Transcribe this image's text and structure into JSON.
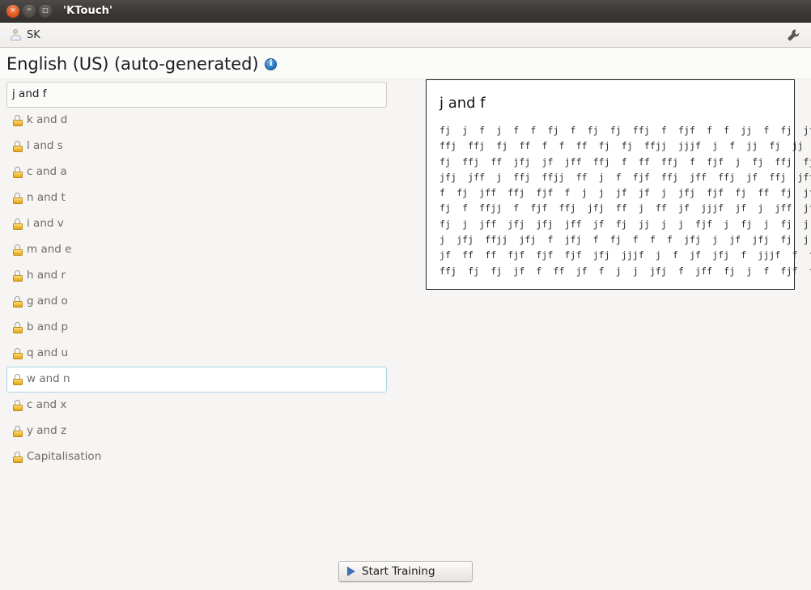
{
  "window": {
    "title": "'KTouch'",
    "controls": {
      "close": "×",
      "minimize": "–",
      "maximize": "□"
    }
  },
  "profile_bar": {
    "user": "SK",
    "avatar_icon": "user-avatar-icon",
    "configure_icon": "wrench-icon"
  },
  "header": {
    "title": "English (US) (auto-generated)",
    "info_icon": "info-icon",
    "info_glyph": "i"
  },
  "lessons": [
    {
      "label": "j and f",
      "locked": false,
      "state": "selected"
    },
    {
      "label": "k and d",
      "locked": true,
      "state": "normal"
    },
    {
      "label": "l and s",
      "locked": true,
      "state": "normal"
    },
    {
      "label": "c and a",
      "locked": true,
      "state": "normal"
    },
    {
      "label": "n and t",
      "locked": true,
      "state": "normal"
    },
    {
      "label": "i and v",
      "locked": true,
      "state": "normal"
    },
    {
      "label": "m and e",
      "locked": true,
      "state": "normal"
    },
    {
      "label": "h and r",
      "locked": true,
      "state": "normal"
    },
    {
      "label": "g and o",
      "locked": true,
      "state": "normal"
    },
    {
      "label": "b and p",
      "locked": true,
      "state": "normal"
    },
    {
      "label": "q and u",
      "locked": true,
      "state": "normal"
    },
    {
      "label": "w and n",
      "locked": true,
      "state": "hover"
    },
    {
      "label": "c and x",
      "locked": true,
      "state": "normal"
    },
    {
      "label": "y and z",
      "locked": true,
      "state": "normal"
    },
    {
      "label": "Capitalisation",
      "locked": true,
      "state": "normal"
    }
  ],
  "preview": {
    "title": "j and f",
    "lines": [
      "fj  j  f  j  f  f  fj  f  fj  fj  ffj  f  fjf  f  f  jj  f  fj  jf  jf  fj  jfj  fjf",
      "ffj  ffj  fj  ff  f  f  ff  fj  fj  ffjj  jjjf  j  f  jj  fj  jj  jfj  ff  f  ff  ff",
      "fj  ffj  ff  jfj  jf  jff  ffj  f  ff  ffj  f  fjf  j  fj  ffj  fj  jj  ffj  jj  f",
      "jfj  jff  j  ffj  ffjj  ff  j  f  fjf  ffj  jff  ffj  jf  ffj  jff  fj  fj  f  f  f",
      "f  fj  jff  ffj  fjf  f  j  j  jf  jf  j  jfj  fjf  fj  ff  fj  jfj  jfj  fj  jff",
      "fj  f  ffjj  f  fjf  ffj  jfj  ff  j  ff  jf  jjjf  jf  j  jff  jfj  j  f  jj  f  jfj",
      "fj  j  jff  jfj  jfj  jff  jf  fj  jj  j  j  fjf  j  fj  j  fj  j  f  j  f  ff  j  ffjj",
      "j  jfj  ffjj  jfj  f  jfj  f  fj  f  f  f  jfj  j  jf  jfj  fj  j  jf  f  fjf  fjf",
      "jf  ff  ff  fjf  fjf  fjf  jfj  jjjf  j  f  jf  jfj  f  jjjf  f  ff  ff  jf  f  fj",
      "ffj  fj  fj  jf  f  ff  jf  f  j  j  jfj  f  jff  fj  j  f  fjf  f  jfj  jf  f  jfj  jjjf"
    ]
  },
  "footer": {
    "start_label": "Start Training",
    "play_icon": "play-triangle-icon"
  },
  "colors": {
    "accent_blue": "#2f7fc4",
    "lock_gold": "#f3c141",
    "play_blue": "#3c72b4",
    "hover_border": "#a8d4e6",
    "titlebar": "#3b3836"
  }
}
